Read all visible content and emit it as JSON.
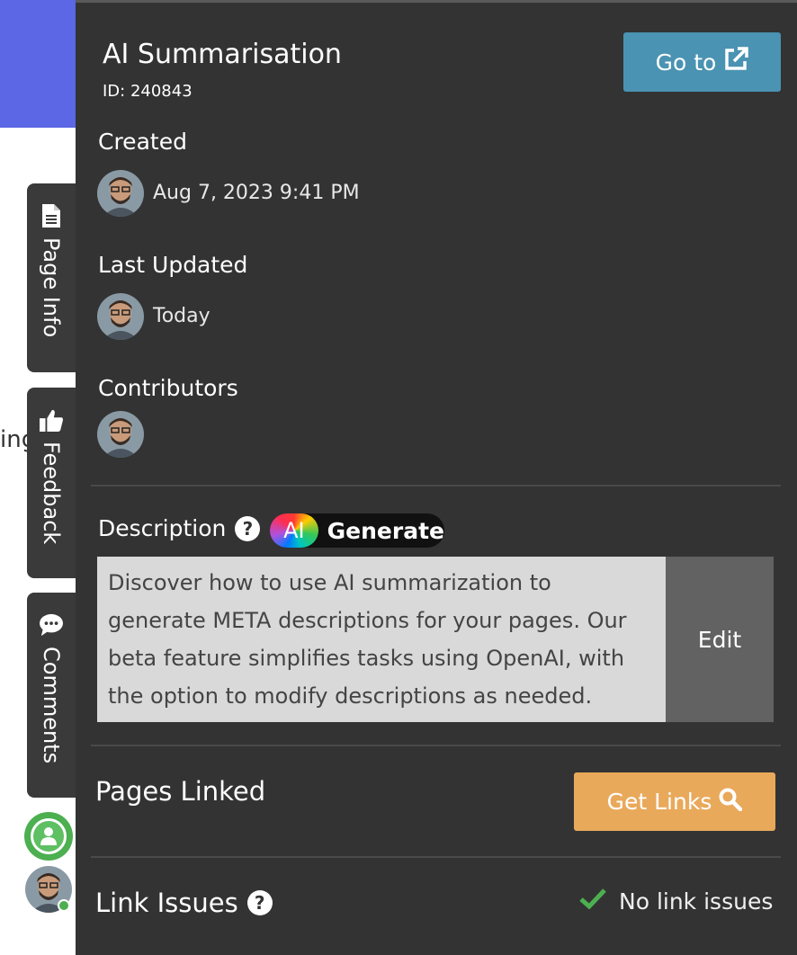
{
  "background": {
    "partial_text": "ing"
  },
  "side_tabs": [
    {
      "label": "Page Info",
      "icon": "document-icon"
    },
    {
      "label": "Feedback",
      "icon": "thumbs-up-icon"
    },
    {
      "label": "Comments",
      "icon": "comment-icon"
    }
  ],
  "panel": {
    "title": "AI Summarisation",
    "id_text": "ID: 240843",
    "goto_label": "Go to",
    "created_label": "Created",
    "created_value": "Aug 7, 2023 9:41 PM",
    "updated_label": "Last Updated",
    "updated_value": "Today",
    "contributors_label": "Contributors",
    "description_label": "Description",
    "ai_badge": "AI",
    "generate_label": "Generate",
    "description_text": "Discover how to use AI summarization to generate META descriptions for your pages. Our beta feature simplifies tasks using OpenAI, with the option to modify descriptions as needed.",
    "edit_label": "Edit",
    "pages_linked_label": "Pages Linked",
    "get_links_label": "Get Links",
    "link_issues_label": "Link Issues",
    "link_status": "No link issues"
  },
  "colors": {
    "panel_bg": "#333333",
    "goto_button": "#4a93b2",
    "get_links_button": "#e9a95b",
    "banner": "#5b67e4",
    "success": "#4caf50"
  }
}
